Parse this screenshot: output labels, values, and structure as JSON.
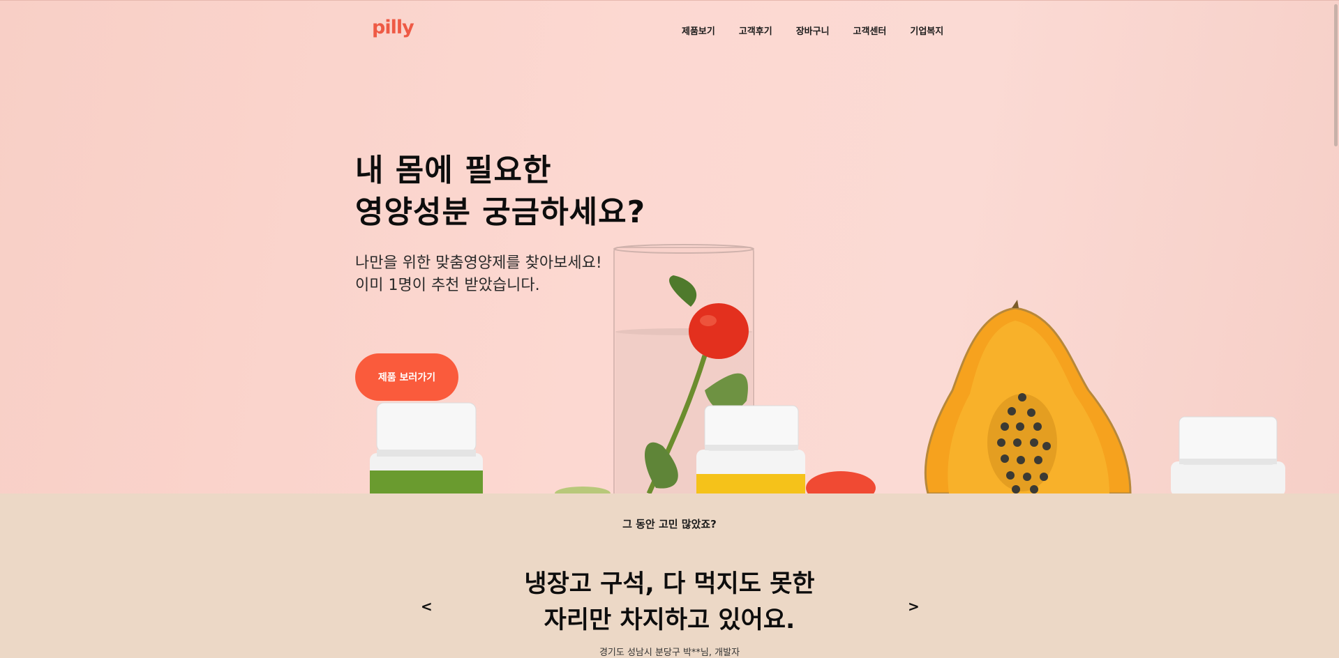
{
  "brand": {
    "logo": "pilly",
    "accent": "#fa5b3c"
  },
  "nav": {
    "items": [
      {
        "label": "제품보기"
      },
      {
        "label": "고객후기"
      },
      {
        "label": "장바구니"
      },
      {
        "label": "고객센터"
      },
      {
        "label": "기업복지"
      }
    ]
  },
  "hero": {
    "headline_line1": "내 몸에 필요한",
    "headline_line2": "영양성분 궁금하세요?",
    "sub_line1": "나만을 위한 맞춤영양제를 찾아보세요!",
    "sub_line2": "이미 1명이 추천 받았습니다.",
    "cta_label": "제품 보러가기"
  },
  "testimonial": {
    "kicker": "그 동안 고민 많았죠?",
    "quote_line1": "냉장고 구석, 다 먹지도 못한",
    "quote_line2": "자리만 차지하고 있어요.",
    "author": "경기도 성남시 분당구 박**님, 개발자",
    "prev_label": "<",
    "next_label": ">"
  },
  "colors": {
    "hero_bg": "#fcd8d1",
    "section_bg": "#ecd8c6",
    "papaya": "#f6a21e",
    "tomato": "#e3301e"
  }
}
